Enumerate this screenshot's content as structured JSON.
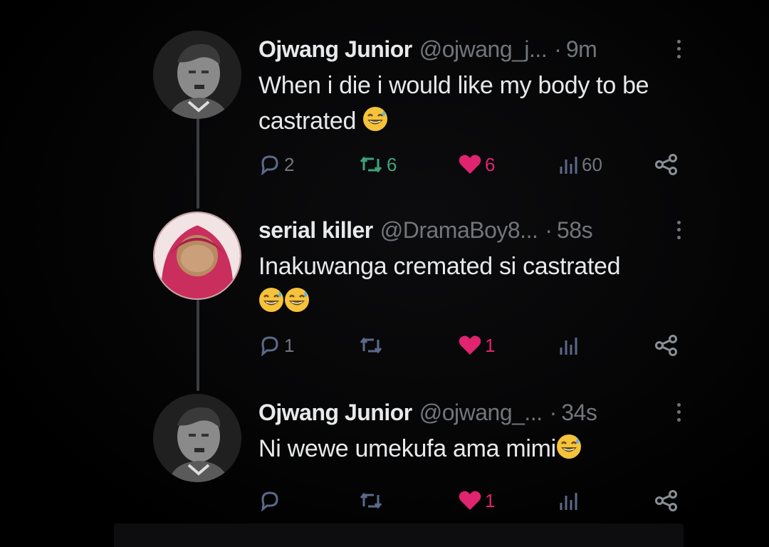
{
  "tweets": [
    {
      "name": "Ojwang Junior",
      "handle": "@ojwang_j...",
      "time": "9m",
      "text": "When i  die i would like my body to be castrated",
      "emoji": [
        "grinning-sweat-emoji"
      ],
      "reply_count": "2",
      "retweet_count": "6",
      "like_count": "6",
      "view_count": "60",
      "retweeted": true,
      "liked": true
    },
    {
      "name": "serial killer",
      "handle": "@DramaBoy8...",
      "time": "58s",
      "text": "Inakuwanga cremated si castrated",
      "emoji": [
        "grinning-sweat-emoji",
        "grinning-sweat-emoji"
      ],
      "reply_count": "1",
      "retweet_count": "",
      "like_count": "1",
      "view_count": "",
      "retweeted": false,
      "liked": true
    },
    {
      "name": "Ojwang Junior",
      "handle": "@ojwang_...",
      "time": "34s",
      "text": "Ni wewe umekufa ama mimi",
      "emoji": [
        "grinning-sweat-emoji"
      ],
      "reply_count": "",
      "retweet_count": "",
      "like_count": "1",
      "view_count": "",
      "retweeted": false,
      "liked": true
    }
  ],
  "separator": "·",
  "colors": {
    "background": "#000000",
    "text": "#e7e9ea",
    "muted": "#71767b",
    "retweet": "#3fa27a",
    "like": "#e0246f",
    "thread_line": "#3a3d41"
  }
}
